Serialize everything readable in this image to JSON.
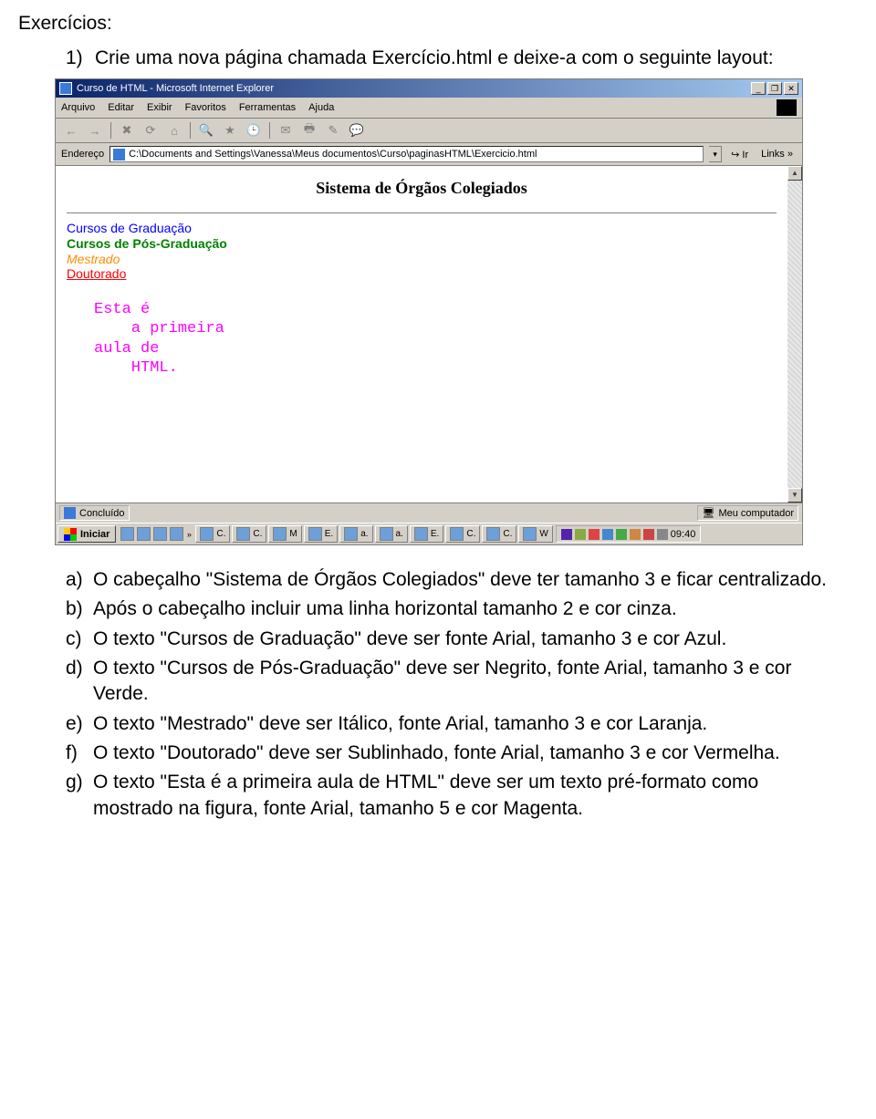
{
  "heading": "Exercícios:",
  "item1_num": "1)",
  "item1_text": "Crie uma nova página chamada Exercício.html e deixe-a com o seguinte layout:",
  "browser": {
    "title": "Curso de HTML - Microsoft Internet Explorer",
    "menus": [
      "Arquivo",
      "Editar",
      "Exibir",
      "Favoritos",
      "Ferramentas",
      "Ajuda"
    ],
    "addr_label": "Endereço",
    "addr_value": "C:\\Documents and Settings\\Vanessa\\Meus documentos\\Curso\\paginasHTML\\Exercicio.html",
    "go_label": "Ir",
    "links_label": "Links",
    "status_left": "Concluído",
    "status_right": "Meu computador",
    "clock": "09:40",
    "start": "Iniciar",
    "tasks": [
      "C.",
      "C.",
      "M",
      "E.",
      "a.",
      "a.",
      "E.",
      "C.",
      "C.",
      "W"
    ]
  },
  "page": {
    "title": "Sistema de Órgãos Colegiados",
    "lines": {
      "l1": "Cursos de Graduação",
      "l2": "Cursos de Pós-Graduação",
      "l3": "Mestrado",
      "l4": "Doutorado"
    },
    "pre": "Esta é\n    a primeira\naula de\n    HTML."
  },
  "sub": {
    "a_l": "a)",
    "a_t": "O cabeçalho \"Sistema de Órgãos Colegiados\" deve ter tamanho 3 e ficar centralizado.",
    "b_l": "b)",
    "b_t": "Após o cabeçalho incluir uma linha horizontal tamanho 2 e cor cinza.",
    "c_l": "c)",
    "c_t": "O texto \"Cursos de Graduação\" deve ser fonte Arial, tamanho 3 e cor Azul.",
    "d_l": "d)",
    "d_t": "O texto \"Cursos de Pós-Graduação\" deve ser Negrito, fonte Arial, tamanho 3 e cor Verde.",
    "e_l": "e)",
    "e_t": "O texto \"Mestrado\" deve ser Itálico, fonte Arial, tamanho 3 e cor Laranja.",
    "f_l": "f)",
    "f_t": "O texto \"Doutorado\" deve ser Sublinhado, fonte Arial, tamanho 3 e cor Vermelha.",
    "g_l": "g)",
    "g_t": "O texto \"Esta é a primeira aula de HTML\" deve ser um texto pré-formato como mostrado na figura, fonte Arial, tamanho 5 e cor Magenta."
  }
}
